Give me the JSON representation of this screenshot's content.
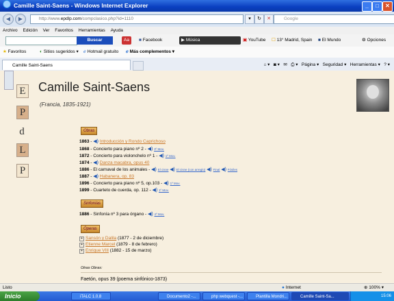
{
  "window": {
    "title": "Camille Saint-Saens - Windows Internet Explorer"
  },
  "address": {
    "prefix": "http://www.",
    "domain": "epdlp.com",
    "path": "/compclasico.php?id=1110",
    "search_placeholder": "Google"
  },
  "menu": [
    "Archivo",
    "Edición",
    "Ver",
    "Favoritos",
    "Herramientas",
    "Ayuda"
  ],
  "toolbar": {
    "search_button": "Buscar",
    "facebook": "Facebook",
    "musica": "Música",
    "youtube": "YouTube",
    "weather": "13° Madrid, Spain",
    "elmundo": "El Mundo",
    "opciones": "Opciones"
  },
  "favorites": {
    "label": "Favoritos",
    "items": [
      "Sitios sugeridos",
      "Hotmail gratuito",
      "Más complementos"
    ]
  },
  "tab": {
    "title": "Camille Saint-Saens"
  },
  "commands": {
    "pagina": "Página",
    "seguridad": "Seguridad",
    "herramientas": "Herramientas"
  },
  "sidebar": {
    "letters": [
      "E",
      "P",
      "d",
      "L",
      "P"
    ]
  },
  "page": {
    "title": "Camille Saint-Saens",
    "lifespan": "(Francia, 1835-1921)",
    "sections": {
      "obras": "Obras",
      "sinfonias": "Sinfonías",
      "operas": "Óperas"
    },
    "works": [
      {
        "year": "1863",
        "link": "Introducción y Rondo Caprichoso",
        "text": "",
        "audio": []
      },
      {
        "year": "1868",
        "link": "",
        "text": "Concierto para piano nº 2",
        "audio": [
          "3º Mov."
        ]
      },
      {
        "year": "1872",
        "link": "",
        "text": "Concierto para violonchelo nº 1",
        "audio": [
          "1º Mov."
        ]
      },
      {
        "year": "1874",
        "link": "Danza macabra, opus 40",
        "text": "",
        "audio": []
      },
      {
        "year": "1886",
        "link": "",
        "text": "El carnaval de los animales",
        "audio": [
          "El cisne",
          "El cisne (con arreglo)",
          "Final",
          "Fósiles"
        ]
      },
      {
        "year": "1887",
        "link": "Habanera, op. 83",
        "text": "",
        "audio": []
      },
      {
        "year": "1896",
        "link": "",
        "text": "Concierto para piano nº 5, op.103",
        "audio": [
          "1º Mov."
        ]
      },
      {
        "year": "1899",
        "link": "",
        "text": "Cuarteto de cuerda, op. 112",
        "audio": [
          "1º Mov."
        ]
      }
    ],
    "symphony": {
      "year": "1886",
      "text": "Sinfonía nº 3 para órgano",
      "audio": "4º Mov."
    },
    "operas": [
      {
        "title": "Sansón y Dalila",
        "date": "(1877 - 2 de diciembre)"
      },
      {
        "title": "Etienne Marcel",
        "date": "(1879 - 8 de febrero)"
      },
      {
        "title": "Enrique VIII",
        "date": "(1882 - 15 de marzo)"
      }
    ],
    "other_label": "Otras Obras:",
    "other_first": "Faetón, opus 39 (poema sinfónico-1873)"
  },
  "status": {
    "left": "Listo",
    "zone": "Internet",
    "zoom": "100%"
  },
  "taskbar": {
    "start": "Inicio",
    "tasks": [
      "iTALC 1.0.8",
      "Documento2 -...",
      "php webquest -...",
      "Plantilla Mondri...",
      "Camille Saint-Sa..."
    ],
    "clock": "15:06"
  },
  "colors": {
    "title_bar": "#0a3fc0",
    "page_bg": "#f7efdf",
    "link": "#c8782b",
    "section_button": "#e2a54a"
  }
}
